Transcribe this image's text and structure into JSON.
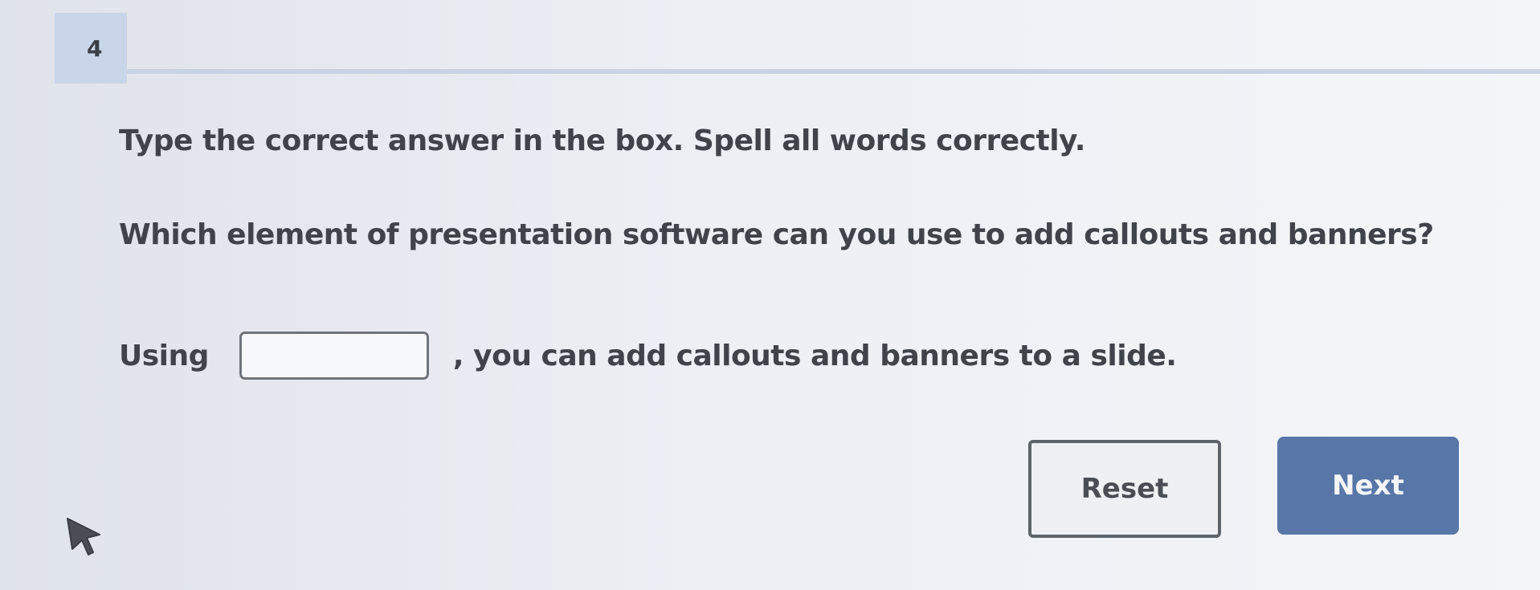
{
  "question": {
    "number": "4",
    "instruction": "Type the correct answer in the box. Spell all words correctly.",
    "prompt": "Which element of presentation software can you use to add callouts and banners?",
    "sentence_before": "Using",
    "sentence_after": ", you can add callouts and banners to a slide.",
    "answer_value": "",
    "answer_placeholder": ""
  },
  "buttons": {
    "reset_label": "Reset",
    "next_label": "Next"
  },
  "icons": {
    "cursor": "mouse-pointer-icon"
  },
  "colors": {
    "accent": "#5876a8",
    "badge": "#c9d5e8"
  }
}
